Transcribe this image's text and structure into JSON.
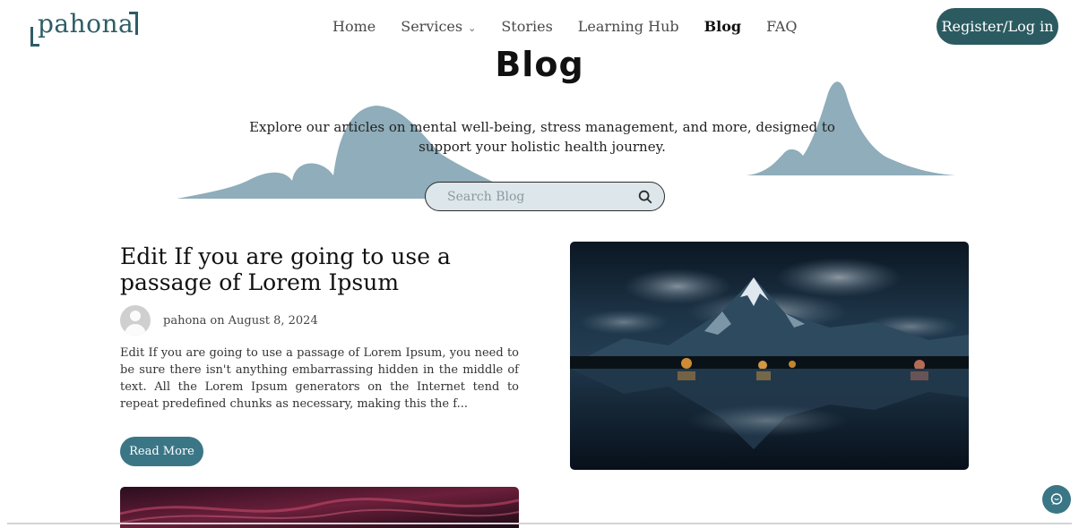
{
  "brand": {
    "logo_text": "pahona"
  },
  "nav": {
    "items": [
      {
        "label": "Home",
        "active": false
      },
      {
        "label": "Services",
        "active": false,
        "dropdown": true
      },
      {
        "label": "Stories",
        "active": false
      },
      {
        "label": "Learning Hub",
        "active": false
      },
      {
        "label": "Blog",
        "active": true
      },
      {
        "label": "FAQ",
        "active": false
      }
    ],
    "dropdown_glyph": "⌄",
    "register_label": "Register/Log in"
  },
  "hero": {
    "title": "Blog",
    "subtitle": "Explore our articles on mental well-being, stress management, and more, designed to support your holistic health journey."
  },
  "search": {
    "placeholder": "Search Blog",
    "icon": "search-icon"
  },
  "post": {
    "title": "Edit If you are going to use a passage of Lorem Ipsum",
    "author": "pahona",
    "date_prefix": "on",
    "date": "August 8, 2024",
    "excerpt": "Edit If you are going to use a passage of Lorem Ipsum, you need to be sure there isn't anything embarrassing hidden in the middle of text. All the Lorem Ipsum generators on the Internet tend to repeat predefined chunks as necessary, making this the f...",
    "read_more_label": "Read More"
  },
  "colors": {
    "primary": "#2b5b61",
    "accent": "#3b7687",
    "hero_shape": "#8fadba",
    "search_bg": "#dde6ea"
  },
  "icons": {
    "chat": "chat-bubble-icon"
  }
}
